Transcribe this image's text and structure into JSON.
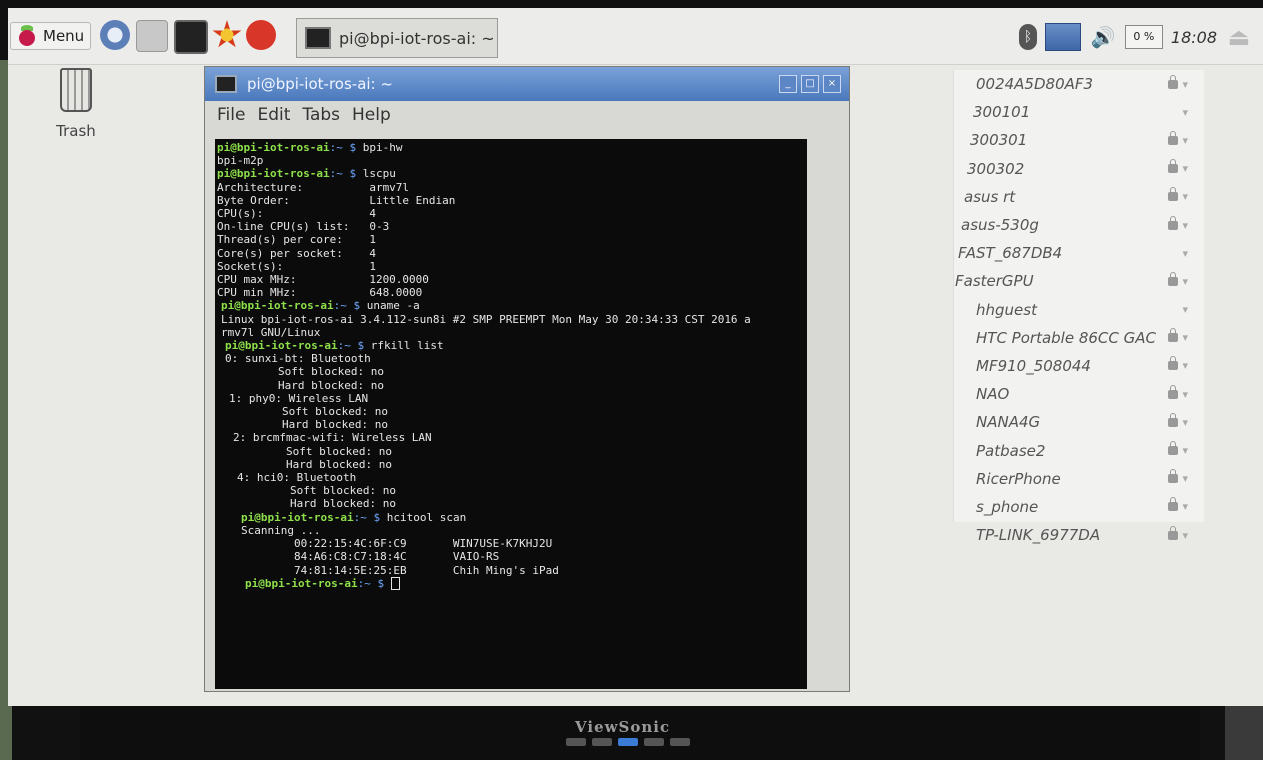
{
  "taskbar": {
    "menu_label": "Menu",
    "task_title": "pi@bpi-iot-ros-ai: ~",
    "tray": {
      "cpu": "0 %",
      "clock": "18:08"
    },
    "icons": [
      "raspberry-menu-icon",
      "web-browser-icon",
      "file-manager-icon",
      "terminal-icon",
      "mathematica-icon",
      "wolfram-icon",
      "bluetooth-icon",
      "network-icon",
      "volume-icon",
      "eject-icon"
    ]
  },
  "desktop": {
    "trash_label": "Trash"
  },
  "terminal": {
    "title": "pi@bpi-iot-ros-ai: ~",
    "menu": [
      "File",
      "Edit",
      "Tabs",
      "Help"
    ],
    "prompt": "pi@bpi-iot-ros-ai",
    "path": ":~ $",
    "lines": [
      {
        "type": "cmd",
        "text": "bpi-hw",
        "indent": 0
      },
      {
        "type": "out",
        "text": "bpi-m2p",
        "indent": 0
      },
      {
        "type": "cmd",
        "text": "lscpu",
        "indent": 0
      },
      {
        "type": "out",
        "text": "Architecture:          armv7l",
        "indent": 0
      },
      {
        "type": "out",
        "text": "Byte Order:            Little Endian",
        "indent": 0
      },
      {
        "type": "out",
        "text": "CPU(s):                4",
        "indent": 0
      },
      {
        "type": "out",
        "text": "On-line CPU(s) list:   0-3",
        "indent": 0
      },
      {
        "type": "out",
        "text": "Thread(s) per core:    1",
        "indent": 0
      },
      {
        "type": "out",
        "text": "Core(s) per socket:    4",
        "indent": 0
      },
      {
        "type": "out",
        "text": "Socket(s):             1",
        "indent": 0
      },
      {
        "type": "out",
        "text": "CPU max MHz:           1200.0000",
        "indent": 0
      },
      {
        "type": "out",
        "text": "CPU min MHz:           648.0000",
        "indent": 0
      },
      {
        "type": "cmd",
        "text": "uname -a",
        "indent": 1
      },
      {
        "type": "out",
        "text": "Linux bpi-iot-ros-ai 3.4.112-sun8i #2 SMP PREEMPT Mon May 30 20:34:33 CST 2016 a",
        "indent": 1
      },
      {
        "type": "out",
        "text": "rmv7l GNU/Linux",
        "indent": 1
      },
      {
        "type": "cmd",
        "text": "rfkill list",
        "indent": 2
      },
      {
        "type": "out",
        "text": "0: sunxi-bt: Bluetooth",
        "indent": 2
      },
      {
        "type": "out",
        "text": "        Soft blocked: no",
        "indent": 2
      },
      {
        "type": "out",
        "text": "        Hard blocked: no",
        "indent": 2
      },
      {
        "type": "out",
        "text": "1: phy0: Wireless LAN",
        "indent": 3
      },
      {
        "type": "out",
        "text": "        Soft blocked: no",
        "indent": 3
      },
      {
        "type": "out",
        "text": "        Hard blocked: no",
        "indent": 3
      },
      {
        "type": "out",
        "text": "2: brcmfmac-wifi: Wireless LAN",
        "indent": 4
      },
      {
        "type": "out",
        "text": "        Soft blocked: no",
        "indent": 4
      },
      {
        "type": "out",
        "text": "        Hard blocked: no",
        "indent": 4
      },
      {
        "type": "out",
        "text": "4: hci0: Bluetooth",
        "indent": 5
      },
      {
        "type": "out",
        "text": "        Soft blocked: no",
        "indent": 5
      },
      {
        "type": "out",
        "text": "        Hard blocked: no",
        "indent": 5
      },
      {
        "type": "cmd",
        "text": "hcitool scan",
        "indent": 6
      },
      {
        "type": "out",
        "text": "Scanning ...",
        "indent": 6
      },
      {
        "type": "out",
        "text": "        00:22:15:4C:6F:C9       WIN7USE-K7KHJ2U",
        "indent": 6
      },
      {
        "type": "out",
        "text": "        84:A6:C8:C7:18:4C       VAIO-RS",
        "indent": 6
      },
      {
        "type": "out",
        "text": "        74:81:14:5E:25:EB       Chih Ming's iPad",
        "indent": 6
      },
      {
        "type": "prompt",
        "text": "",
        "indent": 7
      }
    ]
  },
  "wifi": {
    "networks": [
      {
        "ssid": "0024A5D80AF3",
        "secured": true
      },
      {
        "ssid": "300101",
        "secured": false
      },
      {
        "ssid": "300301",
        "secured": true
      },
      {
        "ssid": "300302",
        "secured": true
      },
      {
        "ssid": "asus rt",
        "secured": true
      },
      {
        "ssid": "asus-530g",
        "secured": true
      },
      {
        "ssid": "FAST_687DB4",
        "secured": false
      },
      {
        "ssid": "FasterGPU",
        "secured": true
      },
      {
        "ssid": "hhguest",
        "secured": false
      },
      {
        "ssid": "HTC Portable 86CC GAC",
        "secured": true
      },
      {
        "ssid": "MF910_508044",
        "secured": true
      },
      {
        "ssid": "NAO",
        "secured": true
      },
      {
        "ssid": "NANA4G",
        "secured": true
      },
      {
        "ssid": "Patbase2",
        "secured": true
      },
      {
        "ssid": "RicerPhone",
        "secured": true
      },
      {
        "ssid": "s_phone",
        "secured": true
      },
      {
        "ssid": "TP-LINK_6977DA",
        "secured": true
      }
    ]
  },
  "monitor": {
    "brand": "ViewSonic"
  }
}
